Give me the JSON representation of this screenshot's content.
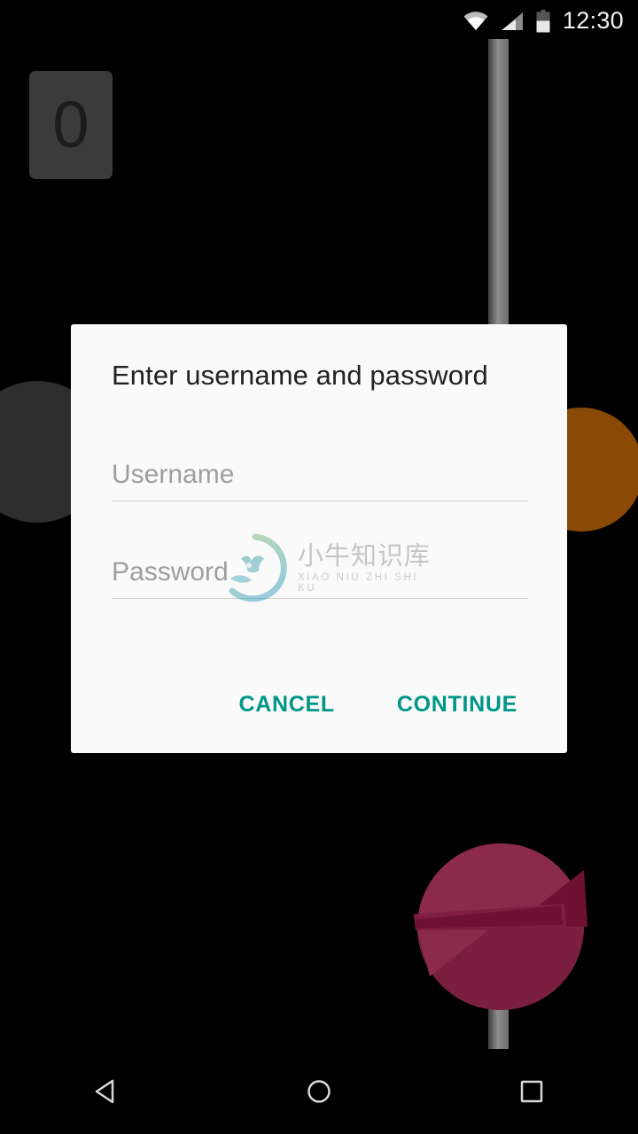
{
  "status_bar": {
    "clock": "12:30",
    "wifi_icon": "wifi-icon",
    "signal_icon": "cellular-signal-icon",
    "battery_icon": "battery-icon",
    "battery_level_percent": 55,
    "icon_color": "#f2f2f2"
  },
  "background": {
    "description": "android-lollipop-easter-egg",
    "tile_zero_label": "0",
    "tile_color": "#3b3b3b",
    "dark_circle_color": "#2e2e2e",
    "orange_circle_color": "#8a4a06",
    "stick_color": "#8d8d8d",
    "lollipop_color": "#8c2a4c",
    "lollipop_shadow_color": "#6e1133"
  },
  "dialog": {
    "title": "Enter username and password",
    "background_color": "#fafafa",
    "fields": [
      {
        "name": "username",
        "placeholder": "Username",
        "value": ""
      },
      {
        "name": "password",
        "placeholder": "Password",
        "value": ""
      }
    ],
    "username_placeholder": "Username",
    "username_value": "",
    "password_placeholder": "Password",
    "password_value": "",
    "cancel_label": "CANCEL",
    "continue_label": "CONTINUE",
    "accent_color": "#009688"
  },
  "watermark": {
    "chinese": "小牛知识库",
    "pinyin": "XIAO NIU ZHI SHI KU",
    "logo_icon": "ox-head-circle-logo",
    "gradient_start": "#8cc07a",
    "gradient_end": "#4aa7c4"
  },
  "nav_bar": {
    "back_icon": "back-triangle-icon",
    "home_icon": "home-circle-icon",
    "recents_icon": "recents-square-icon",
    "icon_color": "#d8d8d8"
  }
}
